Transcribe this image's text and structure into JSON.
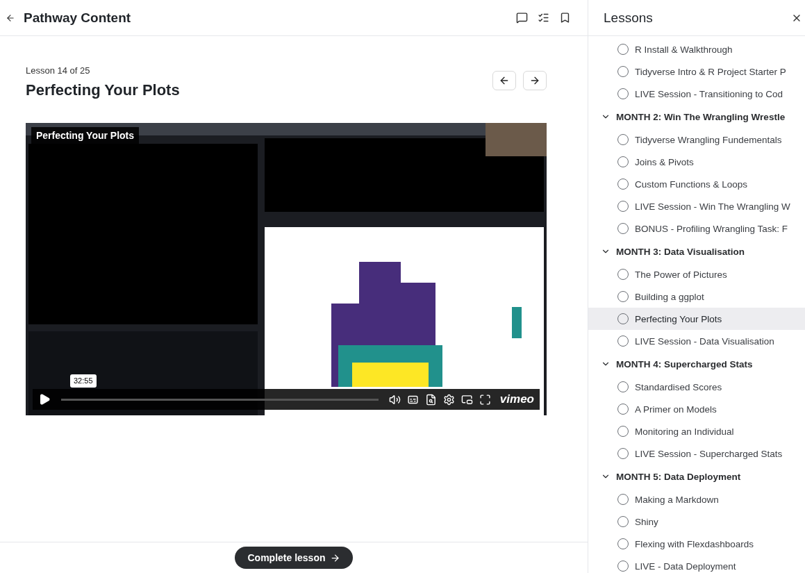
{
  "header": {
    "title": "Pathway Content"
  },
  "lesson": {
    "counter": "Lesson 14 of 25",
    "title": "Perfecting Your Plots"
  },
  "video": {
    "kind": "picture",
    "overlay_title": "Perfecting Your Plots",
    "time_tooltip": "32:55",
    "brand": "vimeo"
  },
  "complete_button": {
    "label": "Complete lesson"
  },
  "lessons_panel": {
    "title": "Lessons",
    "groups": [
      {
        "items": [
          {
            "label": "R Install & Walkthrough",
            "selected": false
          },
          {
            "label": "Tidyverse Intro & R Project Starter P",
            "selected": false
          },
          {
            "label": "LIVE Session - Transitioning to Cod",
            "selected": false
          }
        ]
      },
      {
        "title": "MONTH 2: Win The Wrangling Wrestle",
        "expanded": true,
        "items": [
          {
            "label": "Tidyverse Wrangling Fundementals",
            "selected": false
          },
          {
            "label": "Joins & Pivots",
            "selected": false
          },
          {
            "label": "Custom Functions & Loops",
            "selected": false
          },
          {
            "label": "LIVE Session - Win The Wrangling W",
            "selected": false
          },
          {
            "label": "BONUS - Profiling Wrangling Task: F",
            "selected": false
          }
        ]
      },
      {
        "title": "MONTH 3: Data Visualisation",
        "expanded": true,
        "items": [
          {
            "label": "The Power of Pictures",
            "selected": false
          },
          {
            "label": "Building a ggplot",
            "selected": false
          },
          {
            "label": "Perfecting Your Plots",
            "selected": true
          },
          {
            "label": "LIVE Session - Data Visualisation",
            "selected": false
          }
        ]
      },
      {
        "title": "MONTH 4: Supercharged Stats",
        "expanded": true,
        "items": [
          {
            "label": "Standardised Scores",
            "selected": false
          },
          {
            "label": "A Primer on Models",
            "selected": false
          },
          {
            "label": "Monitoring an Individual",
            "selected": false
          },
          {
            "label": "LIVE Session - Supercharged Stats",
            "selected": false
          }
        ]
      },
      {
        "title": "MONTH 5: Data Deployment",
        "expanded": true,
        "items": [
          {
            "label": "Making a Markdown",
            "selected": false
          },
          {
            "label": "Shiny",
            "selected": false
          },
          {
            "label": "Flexing with Flexdashboards",
            "selected": false
          },
          {
            "label": "LIVE - Data Deployment",
            "selected": false
          }
        ]
      }
    ]
  }
}
